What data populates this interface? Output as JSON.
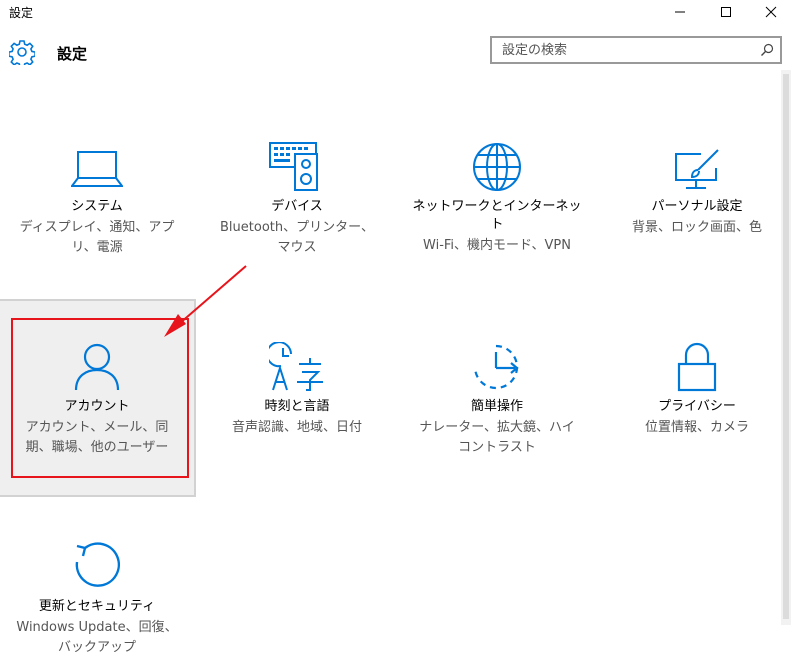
{
  "window": {
    "title": "設定"
  },
  "header": {
    "title": "設定"
  },
  "search": {
    "placeholder": "設定の検索",
    "value": ""
  },
  "accent_color": "#0078d7",
  "annotation_color": "#e8141b",
  "tiles": [
    {
      "id": "system",
      "icon": "laptop-icon",
      "name": "システム",
      "desc": "ディスプレイ、通知、アプリ、電源"
    },
    {
      "id": "devices",
      "icon": "keyboard-speaker-icon",
      "name": "デバイス",
      "desc": "Bluetooth、プリンター、マウス"
    },
    {
      "id": "network",
      "icon": "globe-icon",
      "name": "ネットワークとインターネット",
      "desc": "Wi-Fi、機内モード、VPN"
    },
    {
      "id": "personalization",
      "icon": "paintbrush-screen-icon",
      "name": "パーソナル設定",
      "desc": "背景、ロック画面、色"
    },
    {
      "id": "accounts",
      "icon": "person-icon",
      "name": "アカウント",
      "desc": "アカウント、メール、同期、職場、他のユーザー"
    },
    {
      "id": "time-language",
      "icon": "clock-language-icon",
      "name": "時刻と言語",
      "desc": "音声認識、地域、日付"
    },
    {
      "id": "ease-of-access",
      "icon": "ease-of-access-icon",
      "name": "簡単操作",
      "desc": "ナレーター、拡大鏡、ハイコントラスト"
    },
    {
      "id": "privacy",
      "icon": "lock-icon",
      "name": "プライバシー",
      "desc": "位置情報、カメラ"
    },
    {
      "id": "update-security",
      "icon": "refresh-icon",
      "name": "更新とセキュリティ",
      "desc": "Windows Update、回復、バックアップ"
    }
  ]
}
